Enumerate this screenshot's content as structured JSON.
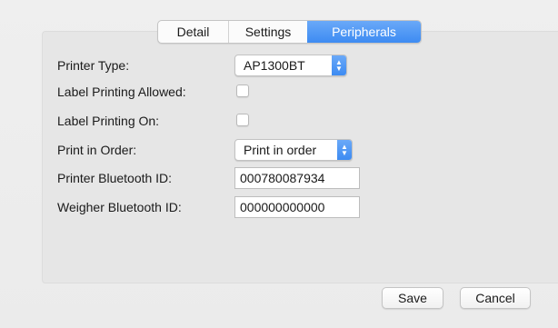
{
  "tabs": [
    {
      "label": "Detail",
      "selected": false
    },
    {
      "label": "Settings",
      "selected": false
    },
    {
      "label": "Peripherals",
      "selected": true
    }
  ],
  "form": {
    "printer_type": {
      "label": "Printer Type:",
      "value": "AP1300BT"
    },
    "label_printing_allowed": {
      "label": "Label Printing Allowed:",
      "checked": false
    },
    "label_printing_on": {
      "label": "Label Printing On:",
      "checked": false
    },
    "print_in_order": {
      "label": "Print in Order:",
      "value": "Print in order"
    },
    "printer_bluetooth_id": {
      "label": "Printer Bluetooth ID:",
      "value": "000780087934"
    },
    "weigher_bluetooth_id": {
      "label": "Weigher Bluetooth ID:",
      "value": "000000000000"
    }
  },
  "buttons": {
    "save": "Save",
    "cancel": "Cancel"
  },
  "colors": {
    "accent": "#3d8bf2",
    "background": "#ececec"
  },
  "icons": {
    "popup_arrows": "up-down-chevron-icon"
  }
}
